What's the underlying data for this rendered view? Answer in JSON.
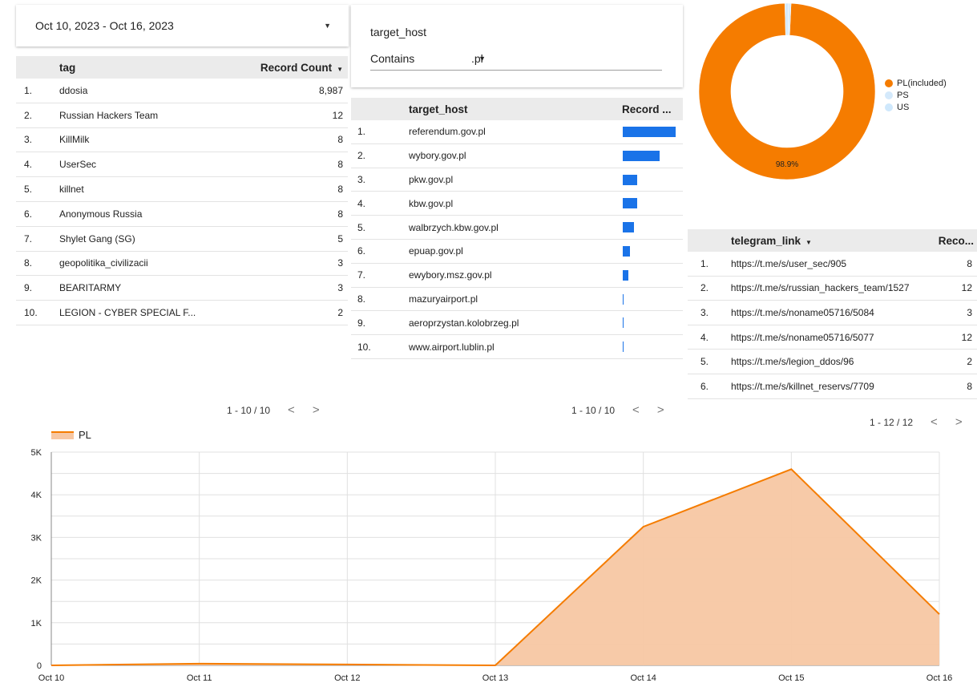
{
  "date_range": {
    "label": "Oct 10, 2023 - Oct 16, 2023"
  },
  "filter": {
    "field_label": "target_host",
    "operator": "Contains",
    "value": ".pl"
  },
  "table_tags": {
    "headers": {
      "tag": "tag",
      "count": "Record Count"
    },
    "rows": [
      {
        "num": "1.",
        "tag": "ddosia",
        "count": "8,987"
      },
      {
        "num": "2.",
        "tag": "Russian Hackers Team",
        "count": "12"
      },
      {
        "num": "3.",
        "tag": "KillMilk",
        "count": "8"
      },
      {
        "num": "4.",
        "tag": "UserSec",
        "count": "8"
      },
      {
        "num": "5.",
        "tag": "killnet",
        "count": "8"
      },
      {
        "num": "6.",
        "tag": "Anonymous Russia",
        "count": "8"
      },
      {
        "num": "7.",
        "tag": "Shylet Gang (SG)",
        "count": "5"
      },
      {
        "num": "8.",
        "tag": "geopolitika_civilizacii",
        "count": "3"
      },
      {
        "num": "9.",
        "tag": "BEARITARMY",
        "count": "3"
      },
      {
        "num": "10.",
        "tag": "LEGION - CYBER SPECIAL F...",
        "count": "2"
      }
    ],
    "pagination": "1 - 10 / 10"
  },
  "table_hosts": {
    "headers": {
      "host": "target_host",
      "record": "Record ..."
    },
    "rows": [
      {
        "num": "1.",
        "host": "referendum.gov.pl",
        "bar": 1.0
      },
      {
        "num": "2.",
        "host": "wybory.gov.pl",
        "bar": 0.69
      },
      {
        "num": "3.",
        "host": "pkw.gov.pl",
        "bar": 0.28
      },
      {
        "num": "4.",
        "host": "kbw.gov.pl",
        "bar": 0.28
      },
      {
        "num": "5.",
        "host": "walbrzych.kbw.gov.pl",
        "bar": 0.21
      },
      {
        "num": "6.",
        "host": "epuap.gov.pl",
        "bar": 0.14
      },
      {
        "num": "7.",
        "host": "ewybory.msz.gov.pl",
        "bar": 0.1
      },
      {
        "num": "8.",
        "host": "mazuryairport.pl",
        "bar": 0.02
      },
      {
        "num": "9.",
        "host": "aeroprzystan.kolobrzeg.pl",
        "bar": 0.02
      },
      {
        "num": "10.",
        "host": "www.airport.lublin.pl",
        "bar": 0.02
      }
    ],
    "pagination": "1 - 10 / 10"
  },
  "table_telegram": {
    "headers": {
      "link": "telegram_link",
      "record": "Reco..."
    },
    "rows": [
      {
        "num": "1.",
        "link": "https://t.me/s/user_sec/905",
        "count": "8"
      },
      {
        "num": "2.",
        "link": "https://t.me/s/russian_hackers_team/1527",
        "count": "12"
      },
      {
        "num": "3.",
        "link": "https://t.me/s/noname05716/5084",
        "count": "3"
      },
      {
        "num": "4.",
        "link": "https://t.me/s/noname05716/5077",
        "count": "12"
      },
      {
        "num": "5.",
        "link": "https://t.me/s/legion_ddos/96",
        "count": "2"
      },
      {
        "num": "6.",
        "link": "https://t.me/s/killnet_reservs/7709",
        "count": "8"
      }
    ],
    "pagination": "1 - 12 / 12"
  },
  "colors": {
    "orange": "#f57c00",
    "orange_fill": "#f7c7a3",
    "light_blue": "#cfe8fc",
    "bar_blue": "#1a73e8"
  },
  "chart_data": [
    {
      "type": "pie",
      "labels": [
        "PL(included)",
        "PS",
        "US"
      ],
      "values": [
        98.9,
        0.7,
        0.4
      ],
      "colors": [
        "#f57c00",
        "#d4e9fb",
        "#cfe8fc"
      ],
      "data_label": "98.9%",
      "legend_position": "right"
    },
    {
      "type": "area",
      "x": [
        "Oct 10",
        "Oct 11",
        "Oct 12",
        "Oct 13",
        "Oct 14",
        "Oct 15",
        "Oct 16"
      ],
      "series": [
        {
          "name": "PL",
          "values": [
            0,
            40,
            20,
            0,
            3250,
            4600,
            1200
          ]
        }
      ],
      "yticks": [
        "0",
        "1K",
        "2K",
        "3K",
        "4K",
        "5K"
      ],
      "ylim": [
        0,
        5000
      ],
      "grid": true,
      "legend_position": "top-left"
    }
  ]
}
